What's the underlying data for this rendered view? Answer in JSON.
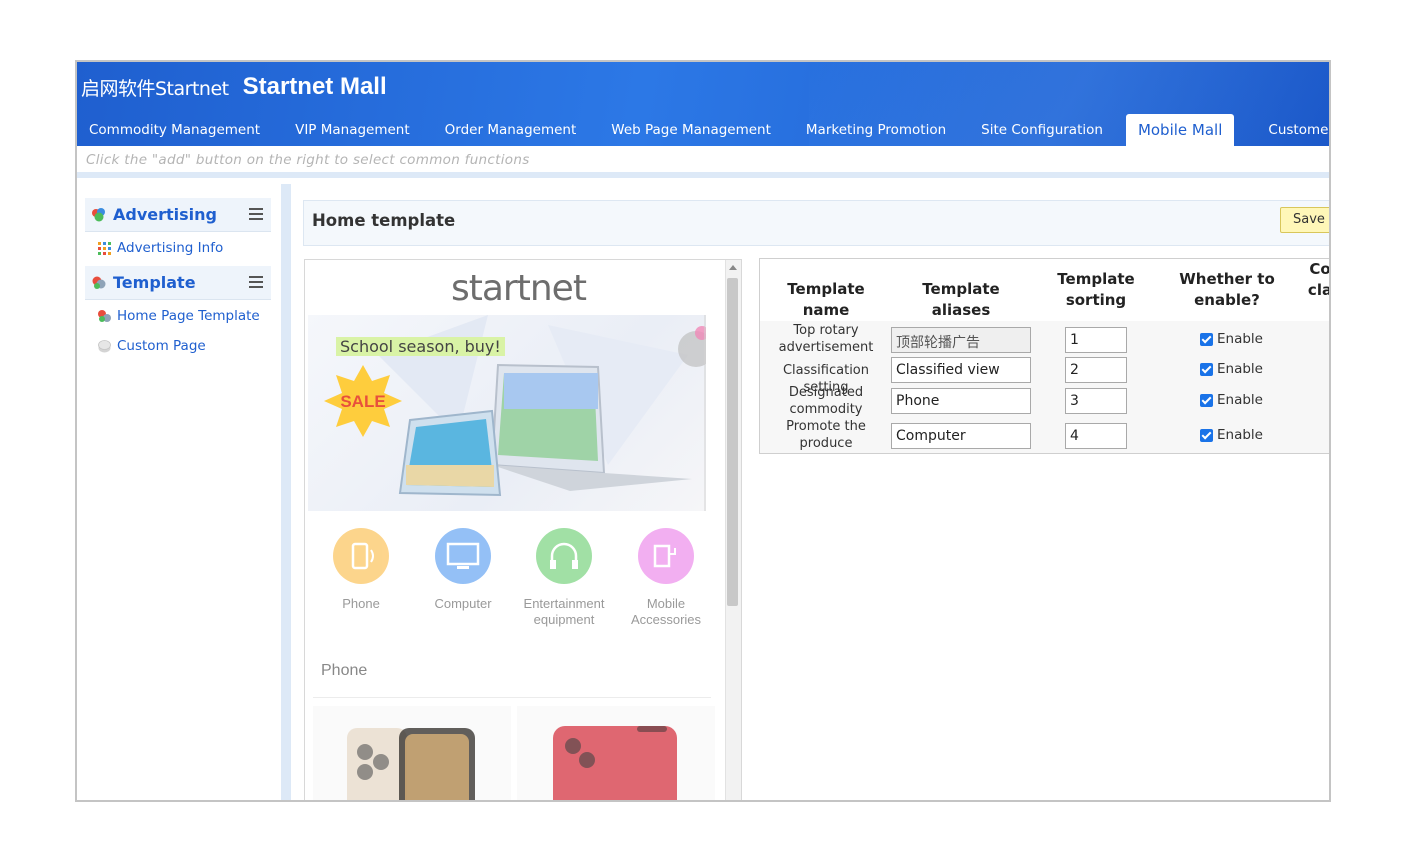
{
  "header": {
    "logo_text": "启网软件Startnet",
    "site_title": "Startnet Mall"
  },
  "nav": {
    "items": [
      {
        "label": "Commodity Management"
      },
      {
        "label": "VIP Management"
      },
      {
        "label": "Order Management"
      },
      {
        "label": "Web Page Management"
      },
      {
        "label": "Marketing Promotion"
      },
      {
        "label": "Site Configuration"
      },
      {
        "label": "Mobile Mall",
        "active": true
      },
      {
        "label": "Customer Service"
      }
    ]
  },
  "hint": "Click the \"add\" button on the right to select common functions",
  "sidebar": {
    "groups": [
      {
        "label": "Advertising",
        "icon": "advertising-icon",
        "items": [
          {
            "label": "Advertising Info",
            "icon": "grid-dots-icon"
          }
        ]
      },
      {
        "label": "Template",
        "icon": "template-icon",
        "items": [
          {
            "label": "Home Page Template",
            "icon": "template-icon"
          },
          {
            "label": "Custom Page",
            "icon": "page-icon"
          }
        ]
      }
    ]
  },
  "main": {
    "title": "Home template",
    "save_label": "Save"
  },
  "preview": {
    "brand": "startnet",
    "banner_slogan": "School season, buy!",
    "banner_sale": "SALE",
    "categories": [
      {
        "label": "Phone",
        "color": "#fbb32f"
      },
      {
        "label": "Computer",
        "color": "#3d8ef0"
      },
      {
        "label": "Entertainment equipment",
        "color": "#55c85c"
      },
      {
        "label": "Mobile Accessories",
        "color": "#e86ee6"
      }
    ],
    "section_title": "Phone"
  },
  "table": {
    "headers": {
      "name": "Template name",
      "alias": "Template aliases",
      "sorting": "Template sorting",
      "enable": "Whether to enable?",
      "extra": "Co cla"
    },
    "rows": [
      {
        "name": "Top rotary advertisement",
        "alias": "顶部轮播广告",
        "sort": "1",
        "enable": "Enable",
        "alias_disabled": true
      },
      {
        "name": "Classification setting",
        "alias": "Classified view",
        "sort": "2",
        "enable": "Enable"
      },
      {
        "name": "Designated commodity",
        "alias": "Phone",
        "sort": "3",
        "enable": "Enable"
      },
      {
        "name": "Promote the produce",
        "alias": "Computer",
        "sort": "4",
        "enable": "Enable"
      }
    ]
  }
}
